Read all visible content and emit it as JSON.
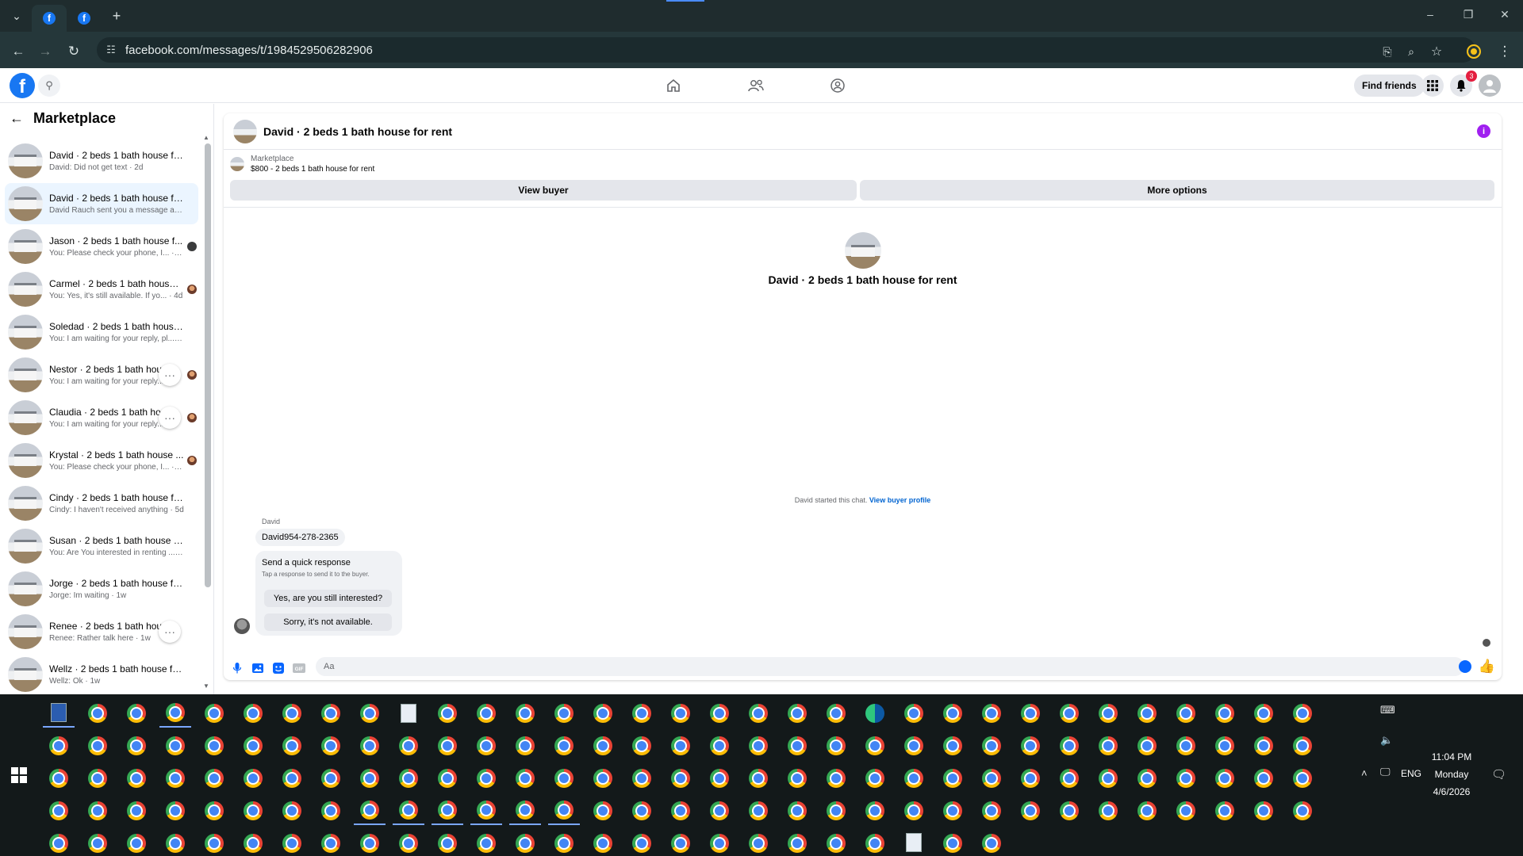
{
  "browser": {
    "url": "facebook.com/messages/t/1984529506282906",
    "new_tab_label": "+",
    "tab_menu_label": "⌄"
  },
  "fbnav": {
    "find_friends_label": "Find friends",
    "notification_count": "3"
  },
  "left_panel": {
    "title": "Marketplace",
    "chats": [
      {
        "name": "David · 2 beds 1 bath house for ...",
        "preview": "David: Did not get text · 2d",
        "selected": false,
        "indicator": "none"
      },
      {
        "name": "David · 2 beds 1 bath house for ...",
        "preview": "David Rauch sent you a message a... · 2d",
        "selected": true,
        "indicator": "none"
      },
      {
        "name": "Jason · 2 beds 1 bath house f...",
        "preview": "You: Please check your phone, I... · 2d",
        "selected": false,
        "indicator": "dot"
      },
      {
        "name": "Carmel · 2 beds 1 bath house ...",
        "preview": "You: Yes, it's still available. If yo... · 4d",
        "selected": false,
        "indicator": "face"
      },
      {
        "name": "Soledad · 2 beds 1 bath house f...",
        "preview": "You: I am waiting for your reply, pl... · 4d",
        "selected": false,
        "indicator": "none"
      },
      {
        "name": "Nestor · 2 beds 1 bath house",
        "preview": "You: I am waiting for your reply...",
        "selected": false,
        "indicator": "face",
        "more": true
      },
      {
        "name": "Claudia · 2 beds 1 bath hous",
        "preview": "You: I am waiting for your reply...",
        "selected": false,
        "indicator": "face",
        "more": true
      },
      {
        "name": "Krystal · 2 beds 1 bath house ...",
        "preview": "You: Please check your phone, I... · 5d",
        "selected": false,
        "indicator": "face"
      },
      {
        "name": "Cindy · 2 beds 1 bath house for ...",
        "preview": "Cindy: I haven't received anything · 5d",
        "selected": false,
        "indicator": "none"
      },
      {
        "name": "Susan · 2 beds 1 bath house for ...",
        "preview": "You: Are You interested in renting ... · 6d",
        "selected": false,
        "indicator": "none"
      },
      {
        "name": "Jorge · 2 beds 1 bath house for ...",
        "preview": "Jorge: Im waiting · 1w",
        "selected": false,
        "indicator": "none"
      },
      {
        "name": "Renee · 2 beds 1 bath house f...",
        "preview": "Renee: Rather talk here · 1w",
        "selected": false,
        "indicator": "none",
        "more": true
      },
      {
        "name": "Wellz · 2 beds 1 bath house for ...",
        "preview": "Wellz: Ok · 1w",
        "selected": false,
        "indicator": "none"
      }
    ]
  },
  "conversation": {
    "title": "David · 2 beds 1 bath house for rent",
    "marketplace_label": "Marketplace",
    "listing": "$800 - 2 beds 1 bath house for rent",
    "view_buyer_label": "View buyer",
    "more_options_label": "More options",
    "center_name": "David · 2 beds 1 bath house for rent",
    "started_text": "David started this chat.",
    "view_buyer_profile_label": "View buyer profile",
    "sender": "David",
    "message": "David954-278-2365",
    "quick_title": "Send a quick response",
    "quick_sub": "Tap a response to send it to the buyer.",
    "quick_reply_1": "Yes, are you still interested?",
    "quick_reply_2": "Sorry, it's not available.",
    "composer_placeholder": "Aa"
  },
  "taskbar": {
    "time": "11:04 PM",
    "day": "Monday",
    "date": "4/6/2026",
    "lang": "ENG"
  },
  "colors": {
    "fb_blue": "#1877f2",
    "messenger_blue": "#0866ff",
    "selected_row": "#ebf5ff",
    "badge_red": "#e41e3f"
  }
}
